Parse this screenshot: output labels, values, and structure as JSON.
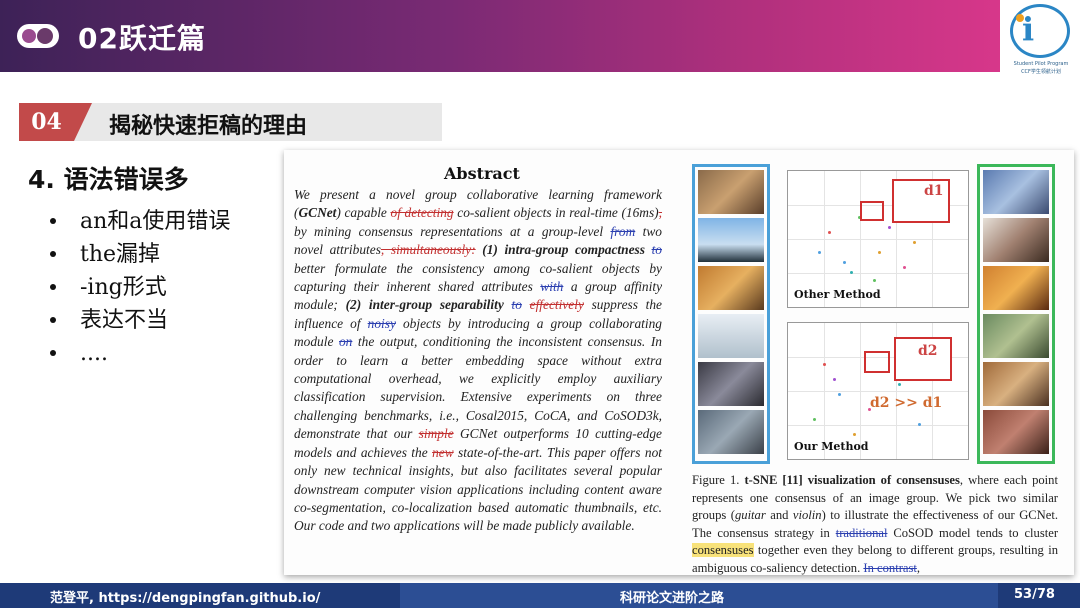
{
  "header": {
    "title": "02跃迁篇"
  },
  "logo": {
    "line1": "Student Pilot Program",
    "line2": "CCF学生领航计划"
  },
  "section": {
    "number": "04",
    "title": "揭秘快速拒稿的理由"
  },
  "content": {
    "heading": "4. 语法错误多",
    "bullets": [
      "an和a使用错误",
      "the漏掉",
      "-ing形式",
      "表达不当",
      "...."
    ]
  },
  "paper": {
    "abstract_title": "Abstract",
    "fig_labels": {
      "top": "Other Method",
      "bottom": "Our Method",
      "d1": "d1",
      "d2": "d2",
      "compare": "d2 >> d1"
    }
  },
  "footer": {
    "left": "范登平, https://dengpingfan.github.io/",
    "center": "科研论文进阶之路",
    "page": "53/78"
  },
  "colors": {
    "accent": "#c24a4a",
    "footer": "#1e3a78"
  }
}
